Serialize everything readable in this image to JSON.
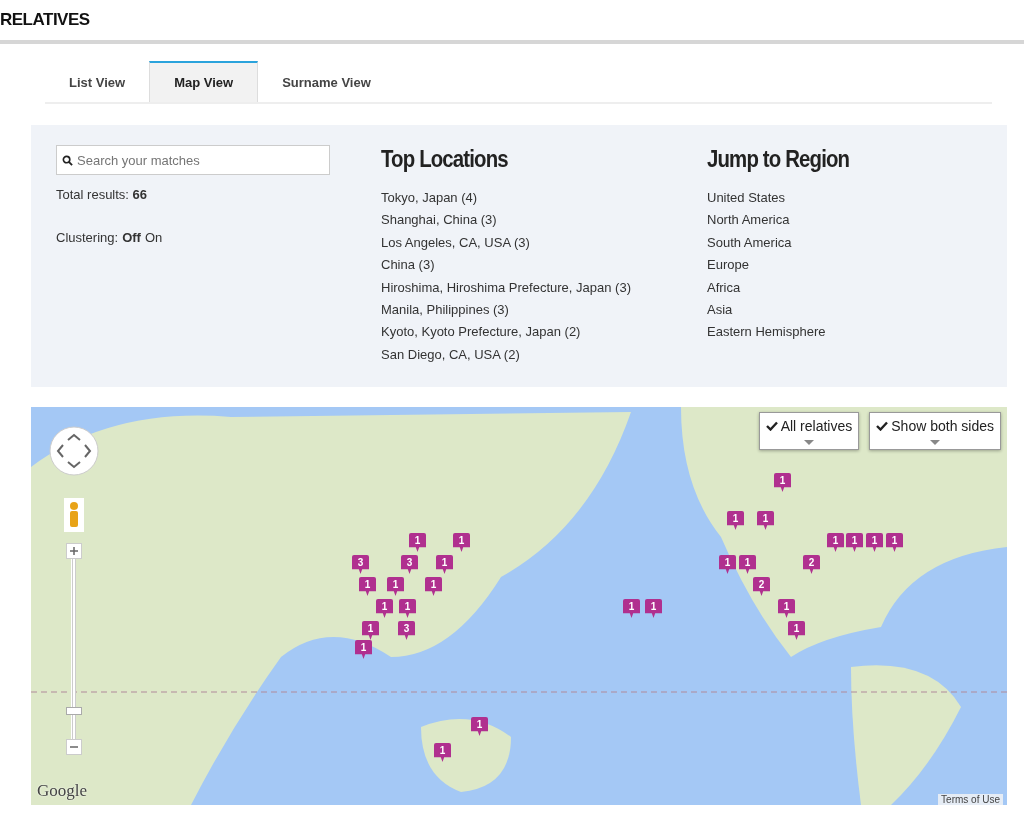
{
  "page_title": "RELATIVES",
  "tabs": [
    {
      "label": "List View",
      "selected": false
    },
    {
      "label": "Map View",
      "selected": true
    },
    {
      "label": "Surname View",
      "selected": false
    }
  ],
  "search": {
    "placeholder": "Search your matches"
  },
  "total": {
    "label": "Total results:",
    "value": "66"
  },
  "clustering": {
    "label": "Clustering:",
    "options": [
      {
        "label": "Off",
        "selected": true
      },
      {
        "label": "On",
        "selected": false
      }
    ]
  },
  "top_locations": {
    "title": "Top Locations",
    "items": [
      "Tokyo, Japan (4)",
      "Shanghai, China (3)",
      "Los Angeles, CA, USA (3)",
      "China (3)",
      "Hiroshima, Hiroshima Prefecture, Japan (3)",
      "Manila, Philippines (3)",
      "Kyoto, Kyoto Prefecture, Japan (2)",
      "San Diego, CA, USA (2)"
    ]
  },
  "regions": {
    "title": "Jump to Region",
    "items": [
      "United States",
      "North America",
      "South America",
      "Europe",
      "Africa",
      "Asia",
      "Eastern Hemisphere"
    ]
  },
  "map": {
    "filters": [
      {
        "label": "All relatives",
        "checked": true
      },
      {
        "label": "Show both sides",
        "checked": true
      }
    ],
    "zoom": {
      "level": 0.15
    },
    "markers": [
      {
        "count": "1"
      },
      {
        "count": "1"
      },
      {
        "count": "1"
      },
      {
        "count": "1"
      },
      {
        "count": "1"
      },
      {
        "count": "1"
      },
      {
        "count": "1"
      },
      {
        "count": "1"
      },
      {
        "count": "1"
      },
      {
        "count": "3"
      },
      {
        "count": "3"
      },
      {
        "count": "1"
      },
      {
        "count": "1"
      },
      {
        "count": "1"
      },
      {
        "count": "2"
      },
      {
        "count": "1"
      },
      {
        "count": "1"
      },
      {
        "count": "1"
      },
      {
        "count": "2"
      },
      {
        "count": "1"
      },
      {
        "count": "1"
      },
      {
        "count": "1"
      },
      {
        "count": "1"
      },
      {
        "count": "1"
      },
      {
        "count": "1"
      },
      {
        "count": "3"
      },
      {
        "count": "1"
      },
      {
        "count": "1"
      },
      {
        "count": "1"
      },
      {
        "count": "1"
      }
    ],
    "logo": "Google",
    "terms": "Terms of Use"
  }
}
